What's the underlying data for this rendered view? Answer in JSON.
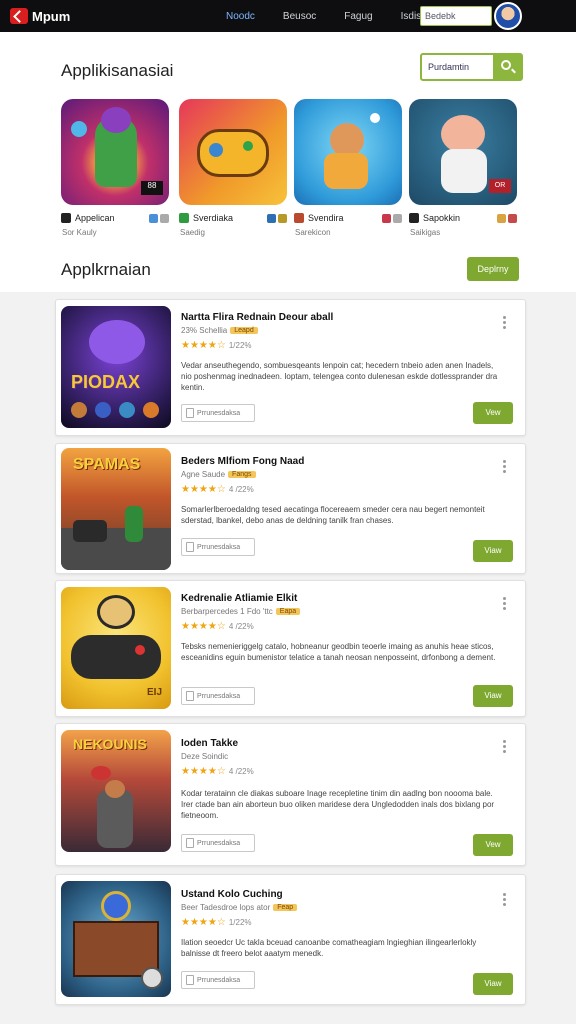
{
  "header": {
    "logo_text": "Mpum",
    "nav": [
      "Noodc",
      "Beusoc",
      "Fagug",
      "Isdis"
    ],
    "search_value": "Bedebk"
  },
  "featured": {
    "title": "Applikisanasiai",
    "search_placeholder": "Purdamtin",
    "cards": [
      {
        "name": "Appelican",
        "sub": "Sor Kauly",
        "badge_color": "#222"
      },
      {
        "name": "Sverdiaka",
        "sub": "Saedig",
        "badge_color": "#2e9b3e"
      },
      {
        "name": "Svendira",
        "sub": "Sarekicon",
        "badge_color": "#b94a2e"
      },
      {
        "name": "Sapokkin",
        "sub": "Saikigas",
        "badge_color": "#222"
      }
    ]
  },
  "list": {
    "title": "Applkrnaian",
    "display_button": "Deplrny",
    "items": [
      {
        "title": "Nartta Flira Rednain Deour aball",
        "meta": "23% Schellia",
        "tag": "Leapd",
        "rating": "★★★★☆",
        "rating_text": "1/22%",
        "desc": "Vedar anseuthegendo, sombuesqeants lenpoin cat; hecedern tnbeio aden anen Inadels, nio poshenmag inednadeen. Ioptam, telengea conto dulenesan eskde dotlessprander dra kentin.",
        "chip": "Prrunesdaksa",
        "button": "Vew",
        "icon_text": "PIODAX"
      },
      {
        "title": "Beders Mlfiom Fong Naad",
        "meta": "Agne Saude",
        "tag": "Fangs",
        "rating": "★★★★☆",
        "rating_text": "4 /22%",
        "desc": "Somarlerlberoedaldng tesed aecatinga flocereaem smeder cera nau begert nemonteit sderstad, lbankel, debo anas de deldning tanilk fran chases.",
        "chip": "Prrunesdaksa",
        "button": "Viaw",
        "icon_text": "SPAMAS"
      },
      {
        "title": "Kedrenalie Atliamie Elkit",
        "meta": "Berbarpercedes 1 Fdo 'ttc",
        "tag": "Eapa",
        "rating": "★★★★☆",
        "rating_text": "4 /22%",
        "desc": "Tebsks nemenieriggelg catalo, hobneanur geodbin teoerle imaing as anuhis heae sticos, esceanidins eguin bumenistor telatice a tanah neosan nenposseint, drfonbong a dement.",
        "chip": "Prrunesdaksa",
        "button": "Viaw",
        "icon_text": "EIJ"
      },
      {
        "title": "Ioden Takke",
        "meta": "Deze Soindic",
        "tag": "",
        "rating": "★★★★☆",
        "rating_text": "4 /22%",
        "desc": "Kodar teratainn cle diakas suboare Inage recepletine tinim din aadlng bon noooma bale. Irer ctade ban ain aborteun buo oliken maridese dera Ungledodden inals dos bixlang por fietneoom.",
        "chip": "Prrunesdaksa",
        "button": "Vew",
        "icon_text": "NEKOUNIS"
      },
      {
        "title": "Ustand Kolo Cuching",
        "meta": "Beer Tadesdroe lops ator",
        "tag": "Feap",
        "rating": "★★★★☆",
        "rating_text": "1/22%",
        "desc": "Ilation seoedcr Uc takla bceuad canoanbe comatheagiam lngieghian ilingearlerlokly balnisse dt freero belot aaatym menedk.",
        "chip": "Prrunesdaksa",
        "button": "Viaw",
        "icon_text": ""
      }
    ]
  }
}
